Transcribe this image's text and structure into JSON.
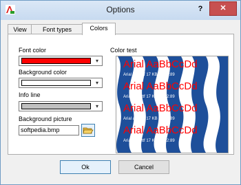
{
  "window": {
    "title": "Options",
    "help": "?",
    "close": "✕"
  },
  "tabs": [
    "View",
    "Font types",
    "Colors"
  ],
  "colors": {
    "font_color_label": "Font color",
    "background_color_label": "Background color",
    "info_line_label": "Info line",
    "background_picture_label": "Background picture",
    "background_picture_value": "softpedia.bmp",
    "color_test_label": "Color test",
    "font_color": "#ff0000",
    "background_color": "#ffffff",
    "info_line_color": "#c0c0c0"
  },
  "preview": {
    "sample_text": "Arial AaBbCcDd",
    "info_text": "Arial   arial.ttf   17 KB   12:12:89"
  },
  "buttons": {
    "ok": "Ok",
    "cancel": "Cancel"
  },
  "icons": {
    "dropdown": "▾",
    "folder": "folder-open-icon"
  }
}
